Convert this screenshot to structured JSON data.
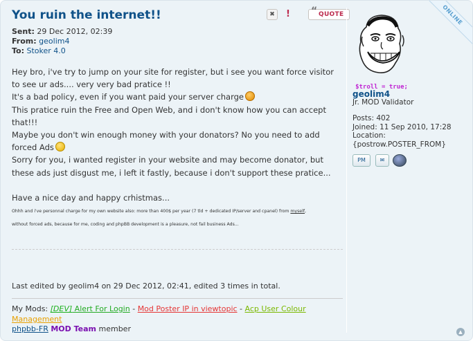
{
  "post": {
    "title": "You ruin the internet!!",
    "buttons": {
      "delete_label": "✖",
      "report_label": "!",
      "quote_label": "QUOTE"
    },
    "meta": {
      "sent_label": "Sent:",
      "sent_value": "29 Dec 2012, 02:39",
      "from_label": "From:",
      "from_value": "geolim4",
      "to_label": "To:",
      "to_value": "Stoker 4.0"
    },
    "content": {
      "p1": "Hey bro, i've try to jump on your site for register, but i see you want force visitor to see ur ads.... very very bad pratice !!",
      "p2": "It's a bad policy, even if you want paid your server charge",
      "p3": "This pratice ruin the Free and Open Web, and i don't know how you can accept that!!!",
      "p4": "Maybe you don't win enough money with your donators? No you need to add forced Ads",
      "p5": "Sorry for you, i wanted register in your website and may become donator, but these ads just disgust me, i left it fastly, because i don't support these pratice...",
      "p6": "Have a nice day and happy crhistmas...",
      "small1_prefix": "Ohhh and i've personnal charge for my own website also: more than 400$ per year (7 tld + dedicated IP/server and cpanel) from ",
      "small1_link": "myself",
      "small1_suffix": ",",
      "small2": "without forced ads, because for me, coding and phpBB development is a pleasure, not fail business Ads..."
    },
    "edited": "Last edited by geolim4 on 29 Dec 2012, 02:41, edited 3 times in total.",
    "signature": {
      "prefix": "My Mods: ",
      "mod1": "[DEV]",
      "mod1b": " Alert For Login",
      "sep1": " - ",
      "mod2": "Mod Poster IP in viewtopic",
      "sep2": " - ",
      "mod3": "Acp User Colour",
      "mod3b": "Management",
      "fr_link": "phpbb-FR",
      "team": "MOD Team",
      "member": " member"
    }
  },
  "profile": {
    "online_badge": "ONLINE",
    "avatar_caption": "$troll = true;",
    "username": "geolim4",
    "rank": "Jr. MOD Validator",
    "posts_label": "Posts:",
    "posts_value": "402",
    "joined_label": "Joined:",
    "joined_value": "11 Sep 2010, 17:28",
    "location_label": "Location:",
    "location_value": "{postrow.POSTER_FROM}",
    "pm_label": "PM"
  },
  "colors": {
    "title": "#105289",
    "background": "#ecf3f7",
    "quote_red": "#bc2a4d",
    "team_purple": "#7a0fb0"
  },
  "icons": {
    "delete": "close-icon",
    "report": "report-icon",
    "quote": "quote-icon",
    "pm": "pm-icon",
    "email": "envelope-icon",
    "www": "globe-icon",
    "top": "arrow-up-icon"
  }
}
